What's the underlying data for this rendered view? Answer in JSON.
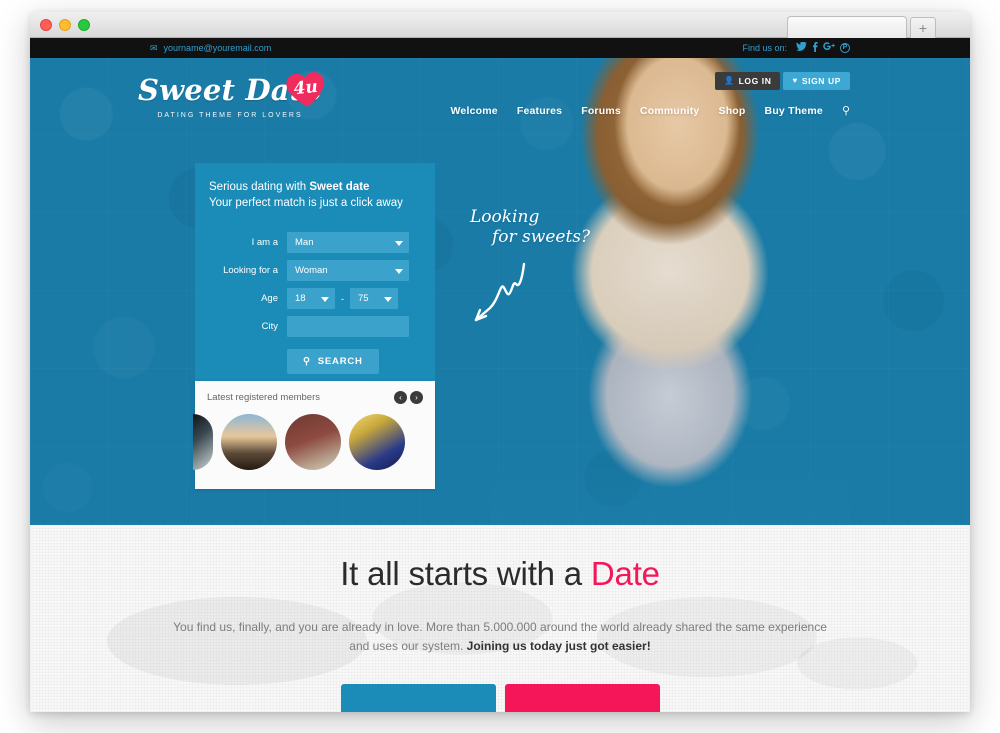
{
  "browser": {
    "new_tab_label": "+",
    "traffic_lights": [
      "close-button",
      "minimize-button",
      "maximize-button"
    ]
  },
  "topbar": {
    "email": "yourname@youremail.com",
    "mail_icon": "envelope-icon",
    "find_us_label": "Find us on:",
    "social": [
      {
        "name": "twitter-icon",
        "glyph": "🐦"
      },
      {
        "name": "facebook-icon",
        "glyph": "f"
      },
      {
        "name": "google-plus-icon",
        "glyph": "g+"
      },
      {
        "name": "pinterest-icon",
        "glyph": "P"
      }
    ]
  },
  "header": {
    "logo": {
      "main": "Sweet Date",
      "badge": "4u",
      "tagline": "DATING THEME FOR LOVERS"
    },
    "auth": {
      "login_label": "LOG IN",
      "login_icon": "user-icon",
      "signup_label": "SIGN UP",
      "signup_icon": "heart-icon"
    },
    "nav": [
      {
        "label": "Welcome"
      },
      {
        "label": "Features"
      },
      {
        "label": "Forums"
      },
      {
        "label": "Community"
      },
      {
        "label": "Shop"
      },
      {
        "label": "Buy Theme"
      }
    ],
    "search_icon": "search-icon"
  },
  "search_panel": {
    "title_prefix": "Serious dating with ",
    "title_brand": "Sweet date",
    "subtitle": "Your perfect match is just a click away",
    "fields": {
      "iam_label": "I am a",
      "iam_value": "Man",
      "looking_label": "Looking for a",
      "looking_value": "Woman",
      "age_label": "Age",
      "age_min": "18",
      "age_dash": "-",
      "age_max": "75",
      "city_label": "City",
      "city_value": "",
      "city_placeholder": ""
    },
    "search_button_label": "SEARCH",
    "search_button_icon": "search-icon"
  },
  "members_panel": {
    "title": "Latest registered members",
    "prev_icon": "chevron-left-icon",
    "next_icon": "chevron-right-icon",
    "prev_glyph": "‹",
    "next_glyph": "›",
    "avatars": [
      {
        "name": "member-avatar-partial"
      },
      {
        "name": "member-avatar-lighthouse"
      },
      {
        "name": "member-avatar-container"
      },
      {
        "name": "member-avatar-concert"
      }
    ]
  },
  "annotation": {
    "line1": "Looking",
    "line2": "for sweets?",
    "arrow_icon": "squiggly-arrow-icon"
  },
  "content": {
    "headline_prefix": "It all starts with a ",
    "headline_accent": "Date",
    "paragraph_part1": "You find us, finally, and you are already in love. More than 5.000.000 around the world already shared the same experience and uses our system. ",
    "paragraph_bold": "Joining us today just got easier!",
    "cta_primary_label": "",
    "cta_secondary_label": ""
  },
  "colors": {
    "hero_blue": "#1b7fab",
    "panel_blue": "#1b8bb8",
    "field_blue": "#3ba2cb",
    "accent_pink": "#f5165a",
    "logo_heart": "#f02b5e",
    "topbar_bg": "#111111",
    "topbar_text": "#2f9fd0",
    "signup_blue": "#3ea8d4",
    "login_dark": "#3b3b3b"
  }
}
